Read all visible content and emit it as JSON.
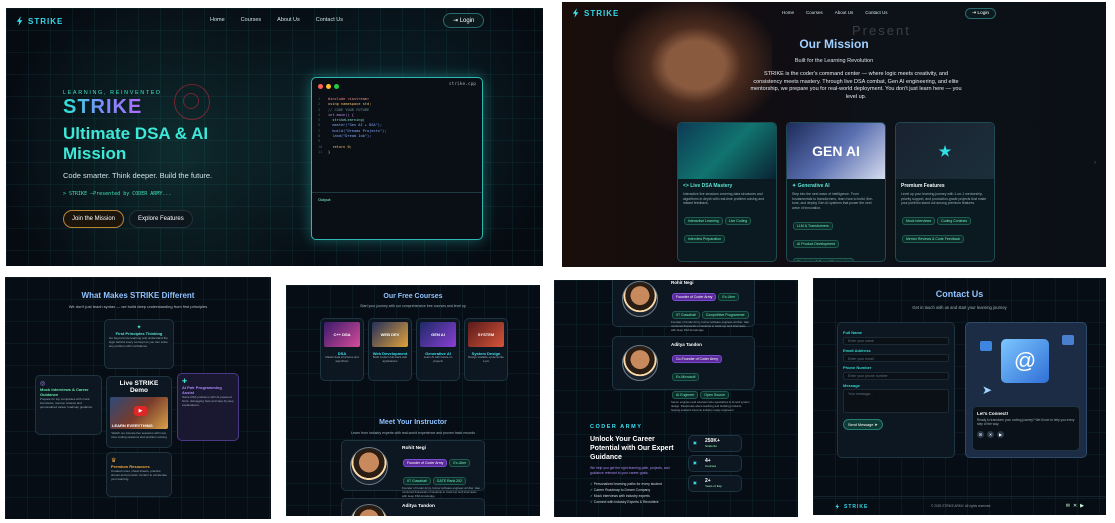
{
  "brand": "STRIKE",
  "nav": {
    "home": "Home",
    "courses": "Courses",
    "about": "About Us",
    "contact": "Contact Us",
    "login": "Login"
  },
  "hero": {
    "eyebrow": "LEARNING, REINVENTED",
    "logo": "STRIKE",
    "title": "Ultimate DSA & AI Mission",
    "tagline": "Code smarter. Think deeper. Build the future.",
    "presented": "> STRIKE –Presented by CODER ARMY...",
    "join_btn": "Join the Mission",
    "explore_btn": "Explore Features",
    "editor_file": "strike.cpp",
    "editor_lines": [
      "#include <iostream>",
      "using namespace std;",
      "// CODE YOUR FUTURE",
      "int main() {",
      "  strikeLearning(",
      "  master(\"Gen AI + DSA\");",
      "  build(\"Dreams Projects\");",
      "  land(\"Dream Job\");",
      "",
      "  return 0;",
      "}"
    ],
    "output_label": "Output:"
  },
  "mission": {
    "bg_word": "Present",
    "title": "Our Mission",
    "subtitle": "Built for the Learning Revolution",
    "body": "STRIKE is the coder's command center — where logic meets creativity, and consistency meets mastery. Through live DSA combat, Gen AI engineering, and elite mentorship, we prepare you for real-world deployment. You don't just learn here — you level up.",
    "cards": [
      {
        "title": "<> Live DSA Mastery",
        "img_text": "",
        "text": "Interactive live sessions covering data structures and algorithms in depth with real-time problem solving and instant feedback.",
        "tags": [
          "Interactive Learning",
          "Live Coding",
          "Interview Preparation"
        ]
      },
      {
        "title": "✦ Generative AI",
        "img_text": "GEN AI",
        "text": "Step into the next wave of intelligence. From fundamentals to transformers, learn how to build, fine-tune, and deploy Gen AI systems that power the next wave of innovation.",
        "tags": [
          "LLM & Transformers",
          "AI Product Development",
          "Fine-tuning & Prompt Engineering",
          "Real-World Projects"
        ]
      },
      {
        "title": "Premium Features",
        "img_text": "★",
        "text": "Level up your learning journey with 1-on-1 mentorship, priority support, and production-grade projects that make your portfolio stand out among premium features.",
        "tags": [
          "Mock Interviews",
          "Coding Contests",
          "Mentor Reviews & Code Feedback"
        ]
      }
    ]
  },
  "why": {
    "title": "What Makes STRIKE Different",
    "subtitle": "We don't just teach syntax — we build deep understanding from first principles",
    "demo_title": "Live STRIKE Demo",
    "demo_thumb": "LEARN EVERYTHING",
    "demo_caption": "Watch our intense live sessions with real-time coding sessions and problem solving",
    "features": [
      {
        "title": "First Principles Thinking",
        "text": "Go beyond rote learning and understand the logic behind every concept so you can solve any problem with confidence."
      },
      {
        "title": "Mock Interviews & Career Guidance",
        "text": "Prepare for top companies with mock interviews, resume reviews and personalized career roadmap guidance."
      },
      {
        "title": "AI Pair Programming Assist",
        "text": "Solve DSA problems with AI-powered hints, debugging help and step-by-step explanations."
      },
      {
        "title": "Premium Resources",
        "text": "Curated notes, cheat sheets, practice sheets and premium content to accelerate your learning."
      }
    ]
  },
  "courses": {
    "title": "Our Free Courses",
    "subtitle": "Start your journey with our comprehensive free courses and level up",
    "items": [
      {
        "name": "DSA",
        "thumb": "C++ DSA",
        "desc": "Master data structures and algorithms"
      },
      {
        "name": "Web Development",
        "thumb": "WEB DEV",
        "desc": "Build modern full-stack web applications"
      },
      {
        "name": "Generative AI",
        "thumb": "GEN AI",
        "desc": "Learn AI with hands-on projects"
      },
      {
        "name": "System Design",
        "thumb": "SYSTEM",
        "desc": "Design scalable systems like a pro"
      }
    ],
    "instructor_title": "Meet Your Instructor",
    "instructor_sub": "Learn from industry experts with real-world experience and proven track records"
  },
  "instructors": [
    {
      "name": "Rohit Negi",
      "badges": [
        "Founder of Coder Army",
        "Ex-Uber"
      ],
      "badges2": [
        "IIT Guwahati",
        "GATE Rank 202",
        "Competitive Programmer"
      ],
      "bio": "Founder of Coder Army, former software engineer at Uber. Has mentored thousands of students to crack top tech interviews with deep DSA knowledge."
    },
    {
      "name": "Aditya Tandon",
      "badges": [
        "Co-Founder of Coder Army",
        "Ex-Microsoft",
        "IIT"
      ],
      "badges2": [
        "AI Engineer",
        "Open Source",
        "Competitive Programmer"
      ],
      "bio": "Senior engineer and educator who specializes in AI and system design. Passionate about teaching and building products, helping students become industry ready engineers."
    }
  ],
  "career": {
    "eyebrow": "CODER ARMY",
    "title": "Unlock Your Career Potential with Our Expert Guidance",
    "sub": "We help you get the right learning path, projects, and guidance relevant to your career goals.",
    "points": [
      "Personalized learning paths for every student",
      "Career Roadmap to Dream Company",
      "Mock interviews with industry experts",
      "Connect with Industry Experts & Recruiters"
    ],
    "stats": [
      {
        "value": "250K+",
        "label": "Students"
      },
      {
        "value": "4+",
        "label": "Courses"
      },
      {
        "value": "2+",
        "label": "Years of Exp"
      }
    ]
  },
  "contact": {
    "title": "Contact Us",
    "subtitle": "Get in touch with us and start your learning journey",
    "name_label": "Full Name",
    "name_ph": "Enter your name",
    "email_label": "Email Address",
    "email_ph": "Enter your email",
    "phone_label": "Phone Number",
    "phone_ph": "Enter your phone number",
    "msg_label": "Message",
    "msg_ph": "Your message...",
    "send": "Send Message ➤",
    "connect_title": "Let's Connect!",
    "connect_text": "Ready to transform your coding journey? We'd love to help you every step of the way.",
    "footer_brand": "STRIKE",
    "footer_copy": "© 2025 STRIKE ARMY. All rights reserved."
  },
  "colors": {
    "accent": "#39e0ee",
    "background": "#070d14",
    "purple": "#9b6cf5",
    "orange": "#f2a93b"
  }
}
